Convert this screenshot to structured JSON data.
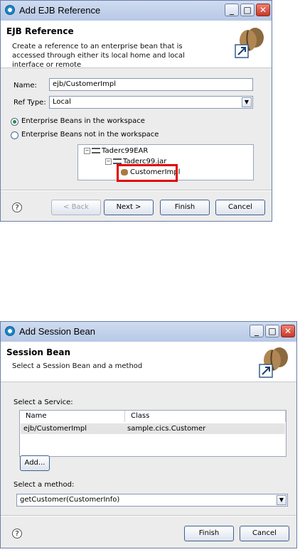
{
  "ejb_dialog": {
    "title": "Add EJB Reference",
    "header_title": "EJB Reference",
    "header_desc": "Create a reference to an enterprise bean that is accessed through either its local home and local interface or remote",
    "name_label": "Name:",
    "name_value": "ejb/CustomerImpl",
    "reftype_label": "Ref Type:",
    "reftype_value": "Local",
    "radio_workspace": "Enterprise Beans in the workspace",
    "radio_not_workspace": "Enterprise Beans not in the workspace",
    "tree": [
      "Taderc99EAR",
      "Taderc99.jar",
      "CustomerImpl"
    ],
    "help": "?",
    "btn_back": "< Back",
    "btn_next": "Next >",
    "btn_finish": "Finish",
    "btn_cancel": "Cancel"
  },
  "session_dialog": {
    "title": "Add Session Bean",
    "header_title": "Session Bean",
    "header_desc": "Select a Session Bean and a method",
    "service_label": "Select a Service:",
    "col_name": "Name",
    "col_class": "Class",
    "row_name": "ejb/CustomerImpl",
    "row_class": "sample.cics.Customer",
    "btn_add": "Add...",
    "method_label": "Select a method:",
    "method_value": "getCustomer(CustomerInfo)",
    "help": "?",
    "btn_finish": "Finish",
    "btn_cancel": "Cancel"
  },
  "icons": {
    "window_min": "_",
    "window_max": "□",
    "window_close": "✕",
    "combo_arrow": "▼"
  },
  "colors": {
    "highlight": "#e00000",
    "title_bar": "#b7c8e6"
  }
}
